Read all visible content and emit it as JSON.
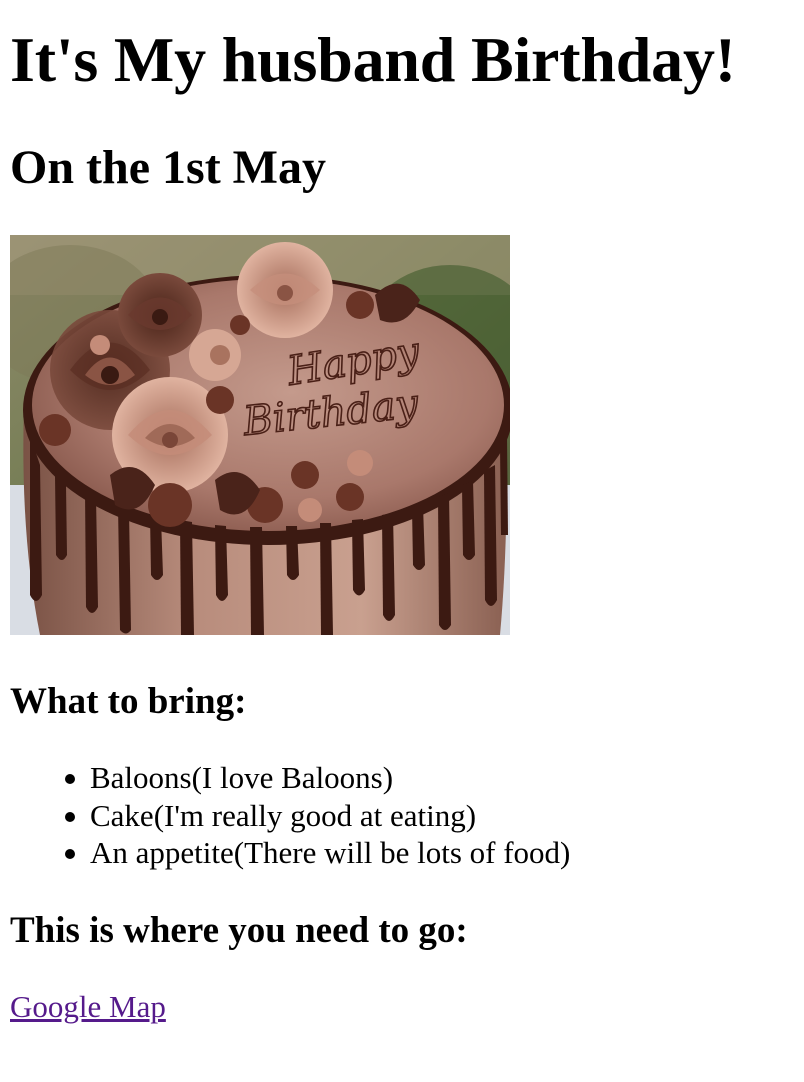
{
  "page": {
    "title": "It's My husband Birthday!",
    "date_heading": "On the 1st May",
    "image": {
      "alt": "Happy Birthday",
      "cake_text_line1": "Happy",
      "cake_text_line2": "Birthday"
    },
    "bring_heading": "What to bring:",
    "bring_items": [
      "Baloons(I love Baloons)",
      "Cake(I'm really good at eating)",
      "An appetite(There will be lots of food)"
    ],
    "where_heading": "This is where you need to go:",
    "map_link_label": "Google Map"
  },
  "colors": {
    "visited_link": "#551a8b",
    "text": "#000000",
    "background": "#ffffff",
    "frosting": "#a6756a",
    "chocolate": "#3c1a12"
  }
}
